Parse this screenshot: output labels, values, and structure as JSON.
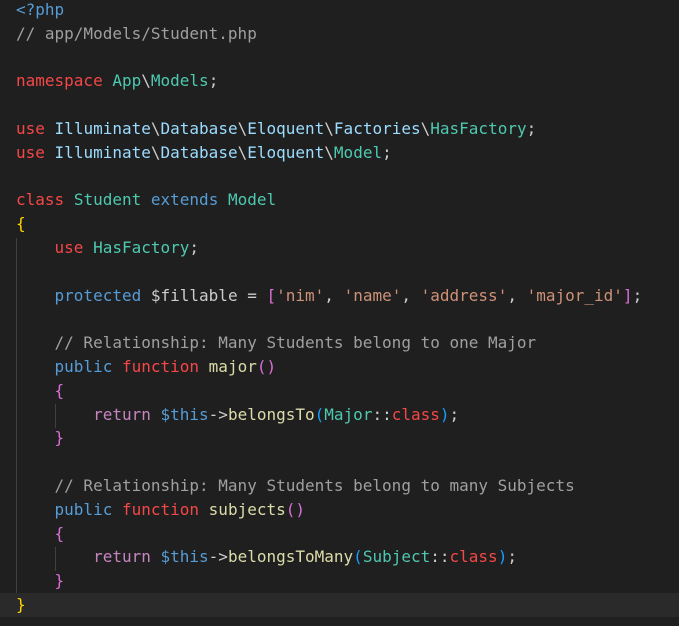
{
  "editor": {
    "language": "php",
    "colors": {
      "background": "#1f1f1f",
      "current_line": "#2a2a2a",
      "bracket_level_1": "#ffd700",
      "bracket_level_2": "#da70d6",
      "bracket_level_3": "#179fff",
      "keyword_control": "#c586c0",
      "keyword_red": "#f44747",
      "class_name": "#4ec9b0",
      "storage": "#569cd6",
      "variable": "#9cdcfe",
      "string": "#ce9178",
      "function": "#dcdcaa",
      "comment": "#9ea09e"
    },
    "current_line_index": 25,
    "lines": [
      {
        "tokens": [
          {
            "t": "<?php",
            "c": "tag"
          }
        ]
      },
      {
        "tokens": [
          {
            "t": "// app/Models/Student.php",
            "c": "comment"
          }
        ]
      },
      {
        "tokens": []
      },
      {
        "tokens": [
          {
            "t": "namespace",
            "c": "red"
          },
          {
            "t": " ",
            "c": "punc"
          },
          {
            "t": "App",
            "c": "ns"
          },
          {
            "t": "\\",
            "c": "punc"
          },
          {
            "t": "Models",
            "c": "ns"
          },
          {
            "t": ";",
            "c": "punc"
          }
        ]
      },
      {
        "tokens": []
      },
      {
        "tokens": [
          {
            "t": "use",
            "c": "red"
          },
          {
            "t": " ",
            "c": "punc"
          },
          {
            "t": "Illuminate",
            "c": "ident"
          },
          {
            "t": "\\",
            "c": "punc"
          },
          {
            "t": "Database",
            "c": "ident"
          },
          {
            "t": "\\",
            "c": "punc"
          },
          {
            "t": "Eloquent",
            "c": "ident"
          },
          {
            "t": "\\",
            "c": "punc"
          },
          {
            "t": "Factories",
            "c": "ident"
          },
          {
            "t": "\\",
            "c": "punc"
          },
          {
            "t": "HasFactory",
            "c": "type"
          },
          {
            "t": ";",
            "c": "punc"
          }
        ]
      },
      {
        "tokens": [
          {
            "t": "use",
            "c": "red"
          },
          {
            "t": " ",
            "c": "punc"
          },
          {
            "t": "Illuminate",
            "c": "ident"
          },
          {
            "t": "\\",
            "c": "punc"
          },
          {
            "t": "Database",
            "c": "ident"
          },
          {
            "t": "\\",
            "c": "punc"
          },
          {
            "t": "Eloquent",
            "c": "ident"
          },
          {
            "t": "\\",
            "c": "punc"
          },
          {
            "t": "Model",
            "c": "type"
          },
          {
            "t": ";",
            "c": "punc"
          }
        ]
      },
      {
        "tokens": []
      },
      {
        "tokens": [
          {
            "t": "class",
            "c": "red"
          },
          {
            "t": " ",
            "c": "punc"
          },
          {
            "t": "Student",
            "c": "type"
          },
          {
            "t": " ",
            "c": "punc"
          },
          {
            "t": "extends",
            "c": "storage"
          },
          {
            "t": " ",
            "c": "punc"
          },
          {
            "t": "Model",
            "c": "type"
          }
        ]
      },
      {
        "tokens": [
          {
            "t": "{",
            "c": "br1"
          }
        ]
      },
      {
        "tokens": [
          {
            "t": "    ",
            "c": "punc"
          },
          {
            "t": "use",
            "c": "red"
          },
          {
            "t": " ",
            "c": "punc"
          },
          {
            "t": "HasFactory",
            "c": "type"
          },
          {
            "t": ";",
            "c": "punc"
          }
        ]
      },
      {
        "tokens": []
      },
      {
        "tokens": [
          {
            "t": "    ",
            "c": "punc"
          },
          {
            "t": "protected",
            "c": "storage"
          },
          {
            "t": " ",
            "c": "punc"
          },
          {
            "t": "$fillable",
            "c": "punc"
          },
          {
            "t": " = ",
            "c": "punc"
          },
          {
            "t": "[",
            "c": "br2"
          },
          {
            "t": "'nim'",
            "c": "str"
          },
          {
            "t": ", ",
            "c": "punc"
          },
          {
            "t": "'name'",
            "c": "str"
          },
          {
            "t": ", ",
            "c": "punc"
          },
          {
            "t": "'address'",
            "c": "str"
          },
          {
            "t": ", ",
            "c": "punc"
          },
          {
            "t": "'major_id'",
            "c": "str"
          },
          {
            "t": "]",
            "c": "br2"
          },
          {
            "t": ";",
            "c": "punc"
          }
        ]
      },
      {
        "tokens": []
      },
      {
        "tokens": [
          {
            "t": "    ",
            "c": "punc"
          },
          {
            "t": "// Relationship: Many Students belong to one Major",
            "c": "comment"
          }
        ]
      },
      {
        "tokens": [
          {
            "t": "    ",
            "c": "punc"
          },
          {
            "t": "public",
            "c": "storage"
          },
          {
            "t": " ",
            "c": "punc"
          },
          {
            "t": "function",
            "c": "red"
          },
          {
            "t": " ",
            "c": "punc"
          },
          {
            "t": "major",
            "c": "func"
          },
          {
            "t": "()",
            "c": "br2"
          }
        ]
      },
      {
        "tokens": [
          {
            "t": "    ",
            "c": "punc"
          },
          {
            "t": "{",
            "c": "br2"
          }
        ]
      },
      {
        "tokens": [
          {
            "t": "        ",
            "c": "punc"
          },
          {
            "t": "return",
            "c": "kw"
          },
          {
            "t": " ",
            "c": "punc"
          },
          {
            "t": "$this",
            "c": "storage"
          },
          {
            "t": "->",
            "c": "punc"
          },
          {
            "t": "belongsTo",
            "c": "func"
          },
          {
            "t": "(",
            "c": "br3"
          },
          {
            "t": "Major",
            "c": "type"
          },
          {
            "t": "::",
            "c": "punc"
          },
          {
            "t": "class",
            "c": "red"
          },
          {
            "t": ")",
            "c": "br3"
          },
          {
            "t": ";",
            "c": "punc"
          }
        ]
      },
      {
        "tokens": [
          {
            "t": "    ",
            "c": "punc"
          },
          {
            "t": "}",
            "c": "br2"
          }
        ]
      },
      {
        "tokens": []
      },
      {
        "tokens": [
          {
            "t": "    ",
            "c": "punc"
          },
          {
            "t": "// Relationship: Many Students belong to many Subjects",
            "c": "comment"
          }
        ]
      },
      {
        "tokens": [
          {
            "t": "    ",
            "c": "punc"
          },
          {
            "t": "public",
            "c": "storage"
          },
          {
            "t": " ",
            "c": "punc"
          },
          {
            "t": "function",
            "c": "red"
          },
          {
            "t": " ",
            "c": "punc"
          },
          {
            "t": "subjects",
            "c": "func"
          },
          {
            "t": "()",
            "c": "br2"
          }
        ]
      },
      {
        "tokens": [
          {
            "t": "    ",
            "c": "punc"
          },
          {
            "t": "{",
            "c": "br2"
          }
        ]
      },
      {
        "tokens": [
          {
            "t": "        ",
            "c": "punc"
          },
          {
            "t": "return",
            "c": "kw"
          },
          {
            "t": " ",
            "c": "punc"
          },
          {
            "t": "$this",
            "c": "storage"
          },
          {
            "t": "->",
            "c": "punc"
          },
          {
            "t": "belongsToMany",
            "c": "func"
          },
          {
            "t": "(",
            "c": "br3"
          },
          {
            "t": "Subject",
            "c": "type"
          },
          {
            "t": "::",
            "c": "punc"
          },
          {
            "t": "class",
            "c": "red"
          },
          {
            "t": ")",
            "c": "br3"
          },
          {
            "t": ";",
            "c": "punc"
          }
        ]
      },
      {
        "tokens": [
          {
            "t": "    ",
            "c": "punc"
          },
          {
            "t": "}",
            "c": "br2"
          }
        ]
      },
      {
        "tokens": [
          {
            "t": "}",
            "c": "br1"
          }
        ]
      }
    ]
  }
}
